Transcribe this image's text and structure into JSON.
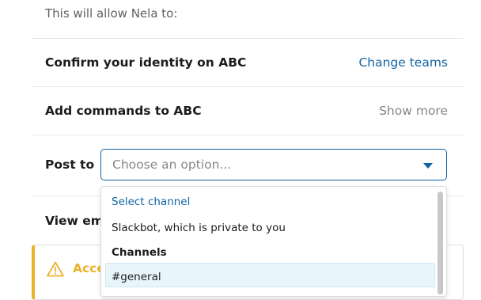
{
  "intro_text": "This will allow Nela to:",
  "permissions": {
    "identity": {
      "label": "Confirm your identity on ABC",
      "action": "Change teams"
    },
    "commands": {
      "label": "Add commands to ABC",
      "action": "Show more"
    }
  },
  "post_to": {
    "label": "Post to",
    "placeholder": "Choose an option..."
  },
  "view_email": {
    "label": "View ema"
  },
  "alert": {
    "text": "Acce",
    "icon": "warning-icon",
    "color": "#ecb22e"
  },
  "dropdown": {
    "select_channel": "Select channel",
    "slackbot": "Slackbot, which is private to you",
    "channels_header": "Channels",
    "highlighted_channel": "#general"
  },
  "colors": {
    "link": "#1264a3",
    "muted": "#868686",
    "warning": "#ecb22e",
    "highlight": "#e8f5fa"
  }
}
